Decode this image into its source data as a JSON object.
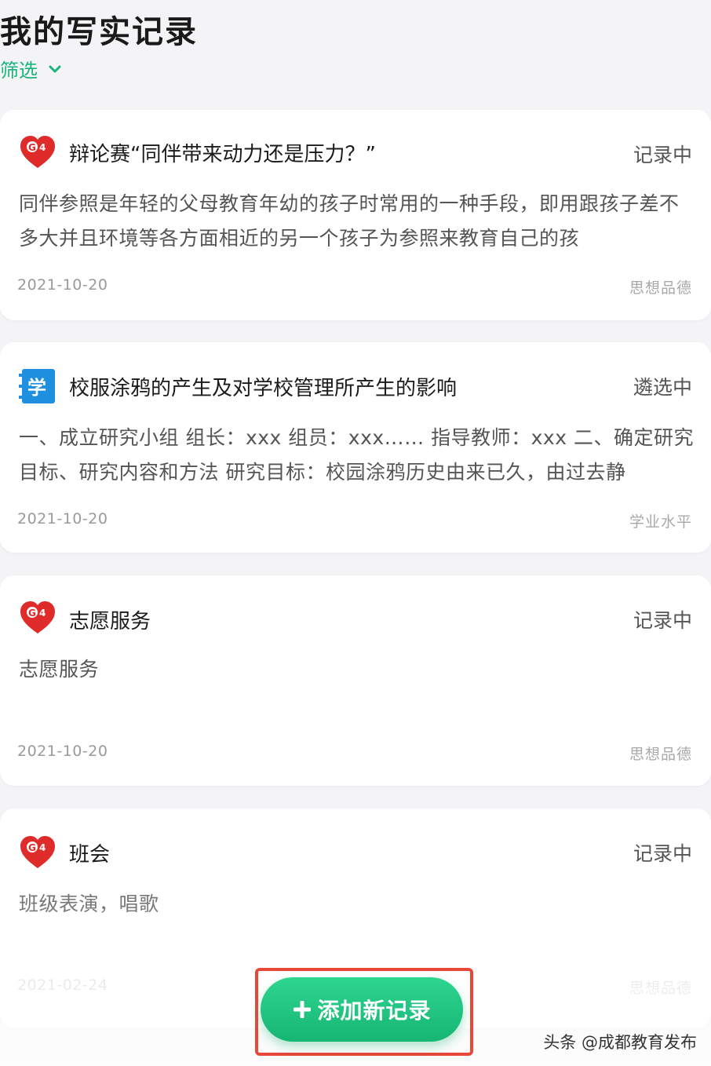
{
  "header": {
    "title": "我的写实记录",
    "filter_label": "筛选"
  },
  "records": [
    {
      "icon": "heart-logo-icon",
      "title": "辩论赛“同伴带来动力还是压力？”",
      "status": "记录中",
      "body": "同伴参照是年轻的父母教育年幼的孩子时常用的一种手段，即用跟孩子差不多大并且环境等各方面相近的另一个孩子为参照来教育自己的孩",
      "date": "2021-10-20",
      "tag": "思想品德"
    },
    {
      "icon": "study-logo-icon",
      "title": "校服涂鸦的产生及对学校管理所产生的影响",
      "status": "遴选中",
      "body": "一、成立研究小组 组长：xxx 组员：xxx…… 指导教师：xxx 二、确定研究目标、研究内容和方法 研究目标：校园涂鸦历史由来已久，由过去静",
      "date": "2021-10-20",
      "tag": "学业水平"
    },
    {
      "icon": "heart-logo-icon",
      "title": "志愿服务",
      "status": "记录中",
      "body": "志愿服务",
      "date": "2021-10-20",
      "tag": "思想品德"
    },
    {
      "icon": "heart-logo-icon",
      "title": "班会",
      "status": "记录中",
      "body": "班级表演，唱歌",
      "date": "2021-02-24",
      "tag": "思想品德"
    }
  ],
  "add_button": {
    "label": "添加新记录",
    "icon": "plus-icon"
  },
  "watermark": "头条 @成都教育发布",
  "colors": {
    "accent": "#18b47b",
    "highlight": "#e8473a",
    "logo_red": "#e02b2b",
    "logo_blue": "#1f8fe0"
  }
}
